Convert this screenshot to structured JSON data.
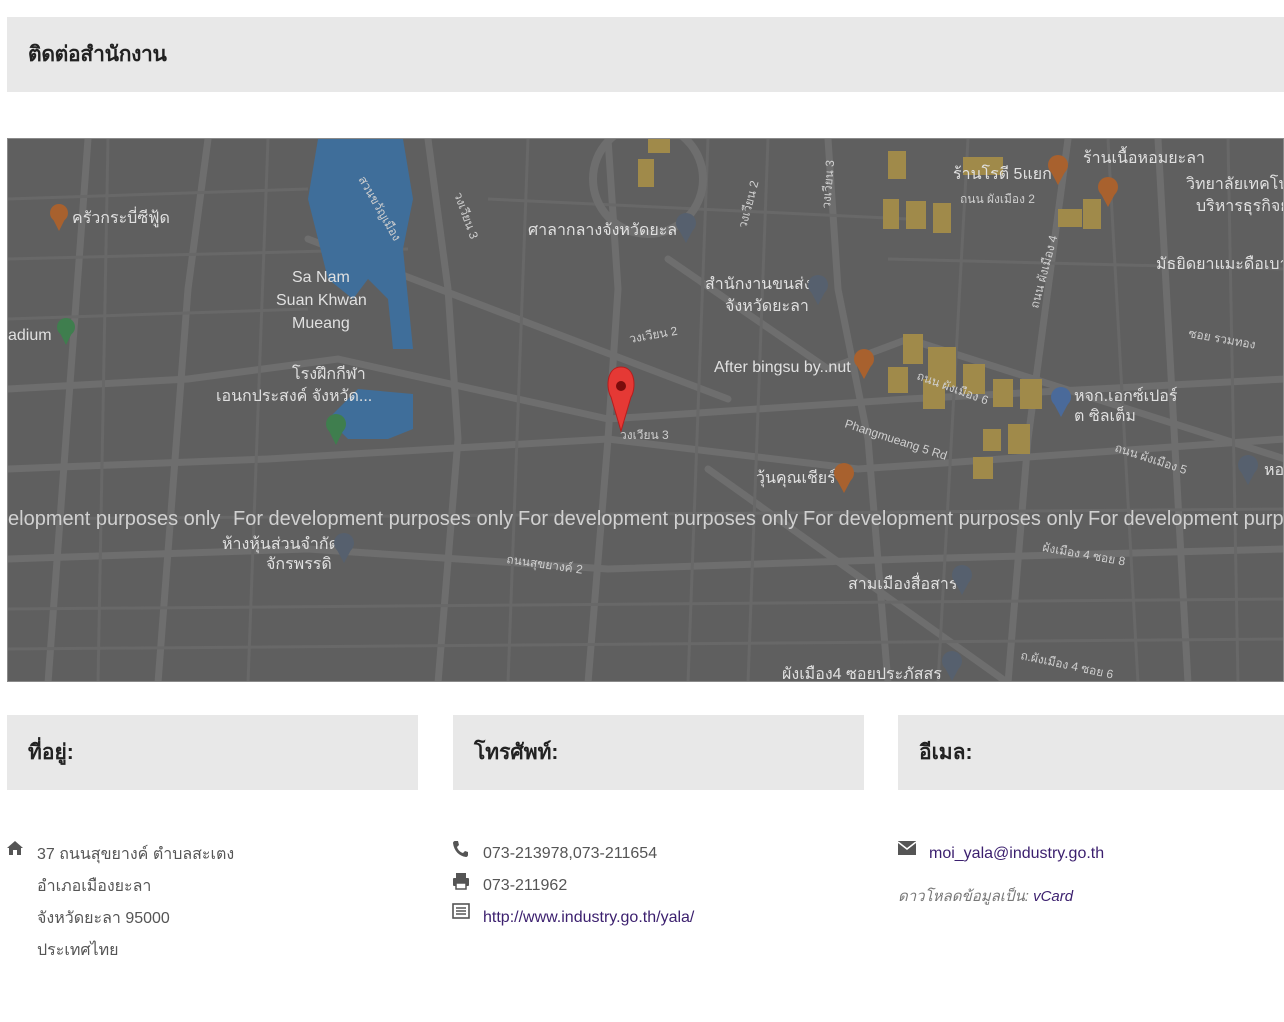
{
  "header": {
    "title": "ติดต่อสำนักงาน"
  },
  "map": {
    "watermark": "For development purposes only",
    "watermark_partial_left": "elopment purposes only",
    "watermark_partial_right": "For development purposes",
    "labels": {
      "rest1": "ครัวกระบี่ซีฟู้ด",
      "sanam1": "Sa Nam",
      "sanam2": "Suan Khwan",
      "sanam3": "Mueang",
      "stadium": "adium",
      "gym1": "โรงฝึกกีฬา",
      "gym2": "เอนกประสงค์ จังหวัด...",
      "lake": "สวนขวัญเมือง",
      "court": "ศาลากลางจังหวัดยะลา",
      "transport1": "สำนักงานขนส่ง",
      "transport2": "จังหวัดยะลา",
      "ring2": "วงเวียน 2",
      "ring3": "วงเวียน 3",
      "ring3b": "วงเวียน 3",
      "ring2b": "วงเวียน 2",
      "ring3c": "วงเวียน 3",
      "bingsu": "After bingsu by..nut",
      "rotti": "ร้านโรตี 5แยก",
      "homyala": "ร้านเนื้อหอมยะลา",
      "college1": "วิทยาลัยเทคโน",
      "college2": "บริหารธุรกิจย",
      "mathayom": "มัธยิดยาแมะดือเบาะ",
      "road_phiang2": "ถนน ผังเมือง 2",
      "road_phiang4": "ถนน ผังเมือง 4",
      "road_phiang6": "ถนน ผังเมือง 6",
      "road_phiang5": "ถนน ผังเมือง 5",
      "soi_ruam": "ซอย รวมทอง",
      "siltem1": "หจก.เอกซ์เปอร์",
      "siltem2": "ต ซิลเต็ม",
      "hoy": "หอ",
      "phangmueang5": "Phangmueang 5 Rd",
      "kunsheer": "วุ้นคุณเชียร์",
      "shop1": "ห้างหุ้นส่วนจำกัด",
      "shop2": "จักรพรรดิ",
      "road_sukhayang2": "ถนนสุขยางค์ 2",
      "soi8": "ผังเมือง 4 ซอย 8",
      "sammueang": "สามเมืองสื่อสาร",
      "soi_prakat": "ผังเมือง4 ซอยประภัสสร",
      "soi6": "ถ.ผังเมือง 4 ซอย 6"
    }
  },
  "address": {
    "heading": "ที่อยู่:",
    "lines": [
      "37 ถนนสุขยางค์ ตำบลสะเตง",
      "อำเภอเมืองยะลา",
      "จังหวัดยะลา 95000",
      "ประเทศไทย"
    ]
  },
  "phone": {
    "heading": "โทรศัพท์:",
    "tel": "073-213978,073-211654",
    "fax": "073-211962",
    "website": "http://www.industry.go.th/yala/"
  },
  "email": {
    "heading": "อีเมล:",
    "address": "moi_yala@industry.go.th",
    "vcard_prefix": "ดาวโหลดข้อมูลเป็น:",
    "vcard_link": "vCard"
  },
  "colors": {
    "map_bg": "#5f5f5f",
    "pin": "#e53935",
    "link": "#3b1f6e",
    "header_bg": "#e8e8e8"
  }
}
